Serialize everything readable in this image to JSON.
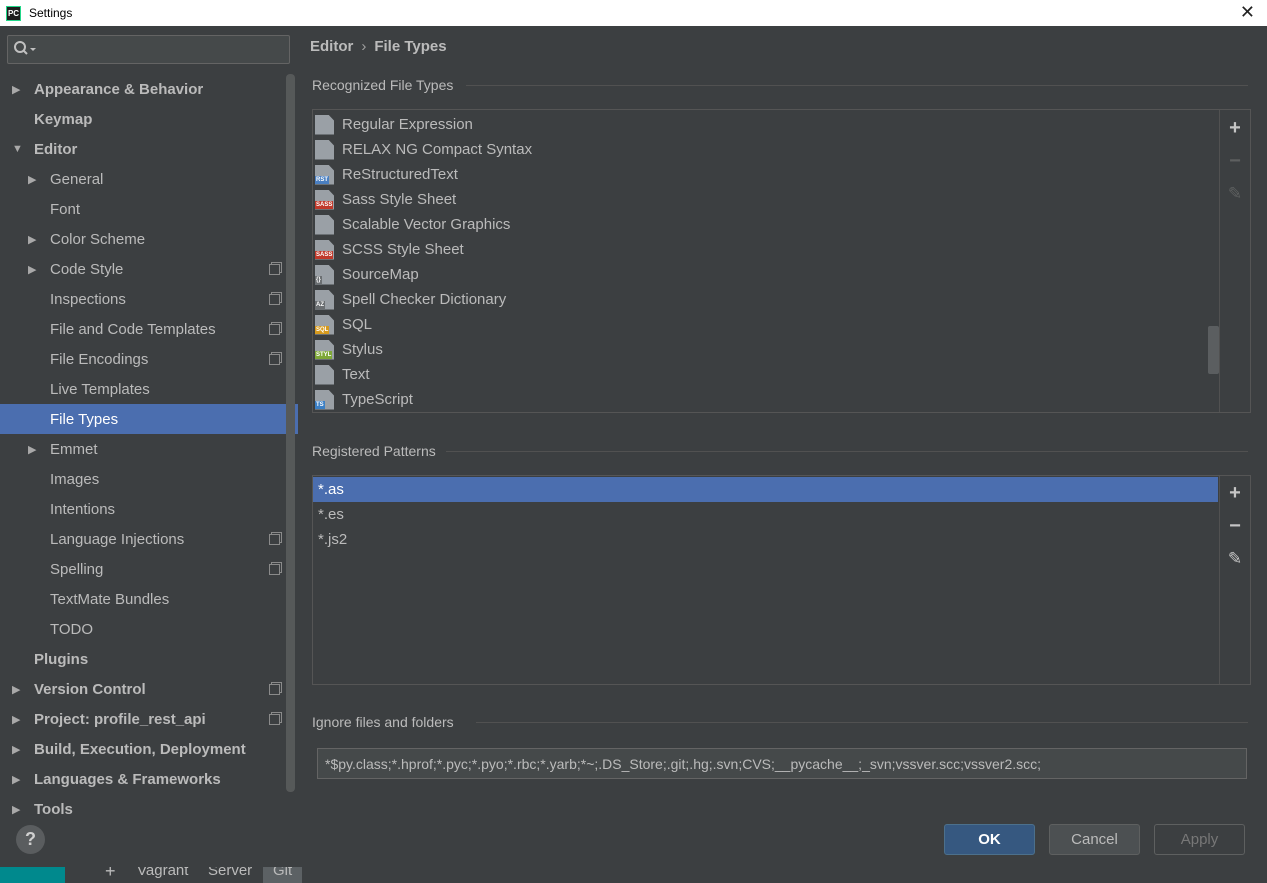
{
  "window": {
    "title": "Settings",
    "app_badge": "PC"
  },
  "search": {
    "placeholder": "",
    "value": ""
  },
  "sidebar": {
    "items": [
      {
        "label": "Appearance & Behavior",
        "level": 0,
        "bold": true,
        "arrow": "right",
        "copy": false
      },
      {
        "label": "Keymap",
        "level": 0,
        "bold": true,
        "arrow": "none",
        "copy": false
      },
      {
        "label": "Editor",
        "level": 0,
        "bold": true,
        "arrow": "down",
        "copy": false
      },
      {
        "label": "General",
        "level": 1,
        "bold": false,
        "arrow": "right",
        "copy": false
      },
      {
        "label": "Font",
        "level": 1,
        "bold": false,
        "arrow": "none",
        "copy": false
      },
      {
        "label": "Color Scheme",
        "level": 1,
        "bold": false,
        "arrow": "right",
        "copy": false
      },
      {
        "label": "Code Style",
        "level": 1,
        "bold": false,
        "arrow": "right",
        "copy": true
      },
      {
        "label": "Inspections",
        "level": 1,
        "bold": false,
        "arrow": "none",
        "copy": true
      },
      {
        "label": "File and Code Templates",
        "level": 1,
        "bold": false,
        "arrow": "none",
        "copy": true
      },
      {
        "label": "File Encodings",
        "level": 1,
        "bold": false,
        "arrow": "none",
        "copy": true
      },
      {
        "label": "Live Templates",
        "level": 1,
        "bold": false,
        "arrow": "none",
        "copy": false
      },
      {
        "label": "File Types",
        "level": 1,
        "bold": false,
        "arrow": "none",
        "copy": false,
        "selected": true
      },
      {
        "label": "Emmet",
        "level": 1,
        "bold": false,
        "arrow": "right",
        "copy": false
      },
      {
        "label": "Images",
        "level": 1,
        "bold": false,
        "arrow": "none",
        "copy": false
      },
      {
        "label": "Intentions",
        "level": 1,
        "bold": false,
        "arrow": "none",
        "copy": false
      },
      {
        "label": "Language Injections",
        "level": 1,
        "bold": false,
        "arrow": "none",
        "copy": true
      },
      {
        "label": "Spelling",
        "level": 1,
        "bold": false,
        "arrow": "none",
        "copy": true
      },
      {
        "label": "TextMate Bundles",
        "level": 1,
        "bold": false,
        "arrow": "none",
        "copy": false
      },
      {
        "label": "TODO",
        "level": 1,
        "bold": false,
        "arrow": "none",
        "copy": false
      },
      {
        "label": "Plugins",
        "level": 0,
        "bold": true,
        "arrow": "none",
        "copy": false
      },
      {
        "label": "Version Control",
        "level": 0,
        "bold": true,
        "arrow": "right",
        "copy": true
      },
      {
        "label": "Project: profile_rest_api",
        "level": 0,
        "bold": true,
        "arrow": "right",
        "copy": true
      },
      {
        "label": "Build, Execution, Deployment",
        "level": 0,
        "bold": true,
        "arrow": "right",
        "copy": false
      },
      {
        "label": "Languages & Frameworks",
        "level": 0,
        "bold": true,
        "arrow": "right",
        "copy": false
      },
      {
        "label": "Tools",
        "level": 0,
        "bold": true,
        "arrow": "right",
        "copy": false
      }
    ]
  },
  "breadcrumb": {
    "parent": "Editor",
    "separator": "›",
    "current": "File Types"
  },
  "recognized": {
    "title": "Recognized File Types",
    "items": [
      {
        "label": "Regular Expression",
        "tag": "",
        "color": "#c9b200"
      },
      {
        "label": "RELAX NG Compact Syntax",
        "tag": "",
        "color": "#9aa0a6"
      },
      {
        "label": "ReStructuredText",
        "tag": "RST",
        "color": "#4a7fc1"
      },
      {
        "label": "Sass Style Sheet",
        "tag": "SASS",
        "color": "#c0392b"
      },
      {
        "label": "Scalable Vector Graphics",
        "tag": "",
        "color": "#3f9a5a"
      },
      {
        "label": "SCSS Style Sheet",
        "tag": "SASS",
        "color": "#c0392b"
      },
      {
        "label": "SourceMap",
        "tag": "{}",
        "color": "#6b6f72"
      },
      {
        "label": "Spell Checker Dictionary",
        "tag": "AZ",
        "color": "#6b6f72"
      },
      {
        "label": "SQL",
        "tag": "SQL",
        "color": "#d69a1e"
      },
      {
        "label": "Stylus",
        "tag": "STYL",
        "color": "#7fa838"
      },
      {
        "label": "Text",
        "tag": "",
        "color": "#9aa0a6"
      },
      {
        "label": "TypeScript",
        "tag": "TS",
        "color": "#3b7fc4"
      }
    ]
  },
  "patterns": {
    "title": "Registered Patterns",
    "items": [
      "*.as",
      "*.es",
      "*.js2"
    ]
  },
  "ignore": {
    "title": "Ignore files and folders",
    "value": "*$py.class;*.hprof;*.pyc;*.pyo;*.rbc;*.yarb;*~;.DS_Store;.git;.hg;.svn;CVS;__pycache__;_svn;vssver.scc;vssver2.scc;"
  },
  "tools": {
    "add": "+",
    "remove": "−",
    "edit": "✎"
  },
  "buttons": {
    "help": "?",
    "ok": "OK",
    "cancel": "Cancel",
    "apply": "Apply"
  },
  "taskbar": {
    "plus": "+",
    "vagrant": "Vagrant",
    "server": "Server",
    "git": "Git"
  },
  "colors": {
    "selection": "#4b6eaf",
    "background": "#3c3f41",
    "ok_button": "#365880"
  }
}
